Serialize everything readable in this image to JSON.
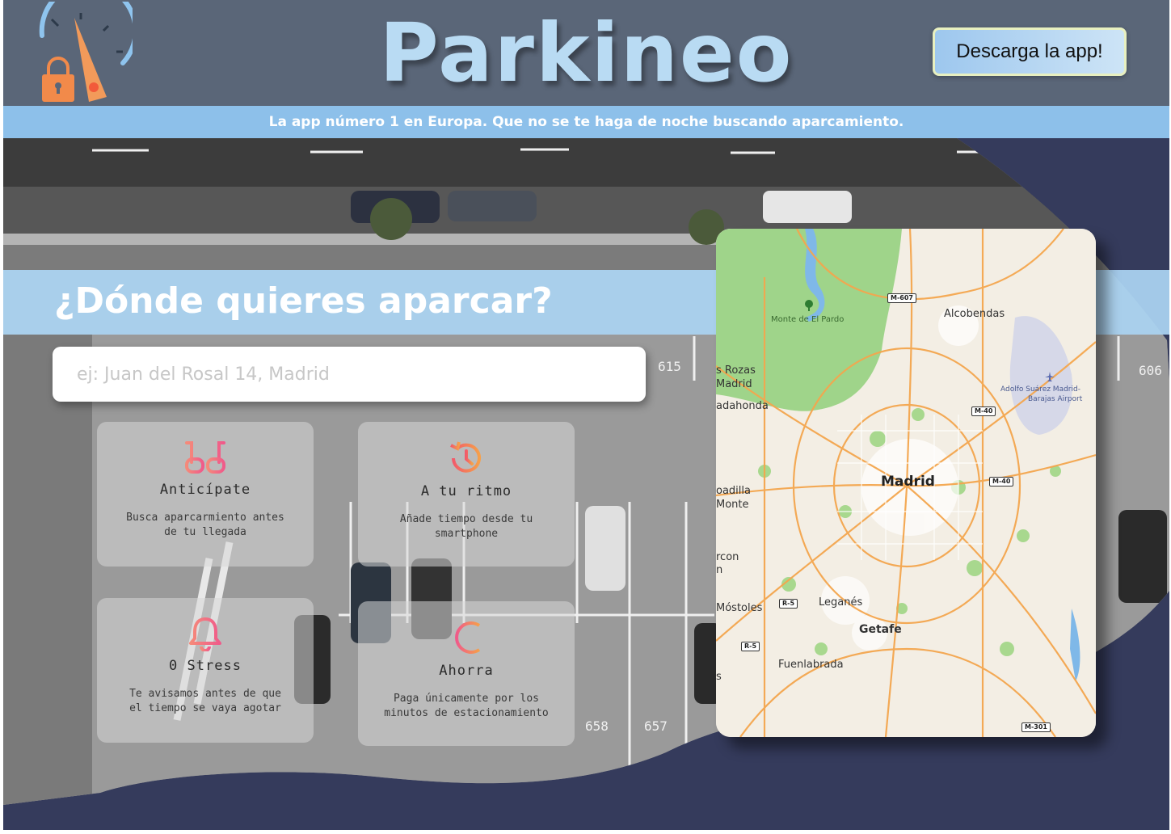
{
  "header": {
    "brand": "Parkineo",
    "download_label": "Descarga la app!"
  },
  "tagline": "La app número 1 en Europa. Que no se te haga de noche buscando aparcamiento.",
  "hero": {
    "question": "¿Dónde quieres aparcar?",
    "search_placeholder": "ej: Juan del Rosal 14, Madrid"
  },
  "features": [
    {
      "icon": "glasses-icon",
      "title": "Anticípate",
      "desc_line1": "Busca aparcarmiento antes",
      "desc_line2": "de tu llegada"
    },
    {
      "icon": "history-clock-icon",
      "title": "A tu ritmo",
      "desc_line1": "Añade tiempo desde tu",
      "desc_line2": "smartphone"
    },
    {
      "icon": "bell-icon",
      "title": "0 Stress",
      "desc_line1": "Te avisamos antes de que",
      "desc_line2": "el tiempo se vaya agotar"
    },
    {
      "icon": "euro-icon",
      "title": "Ahorra",
      "desc_line1": "Paga únicamente por los",
      "desc_line2": "minutos de estacionamiento"
    }
  ],
  "map": {
    "labels": {
      "madrid": "Madrid",
      "alcobendas": "Alcobendas",
      "monte_pardo": "Monte de El Pardo",
      "airport_1": "Adolfo Suárez Madrid-",
      "airport_2": "Barajas Airport",
      "las_rozas_1": "s Rozas",
      "las_rozas_2": "Madrid",
      "majadahonda": "adahonda",
      "boadilla_1": "oadilla",
      "boadilla_2": "Monte",
      "alcorcon_1": "rcon",
      "alcorcon_2": "n",
      "mostoles": "Móstoles",
      "leganes": "Leganés",
      "getafe": "Getafe",
      "fuenlabrada": "Fuenlabrada",
      "edge_s": "s"
    },
    "roads": {
      "m607": "M-607",
      "m40_ne": "M-40",
      "m40_e": "M-40",
      "r5_a": "R-5",
      "r5_b": "R-5",
      "m301": "M-301"
    }
  },
  "colors": {
    "header_bg": "#5a6678",
    "tagline_bg": "#8dc0ea",
    "brand": "#b9dbf3",
    "accent_gradient_start": "#f6a04a",
    "accent_gradient_end": "#f25a8a",
    "frame_bg": "#353b5c"
  }
}
